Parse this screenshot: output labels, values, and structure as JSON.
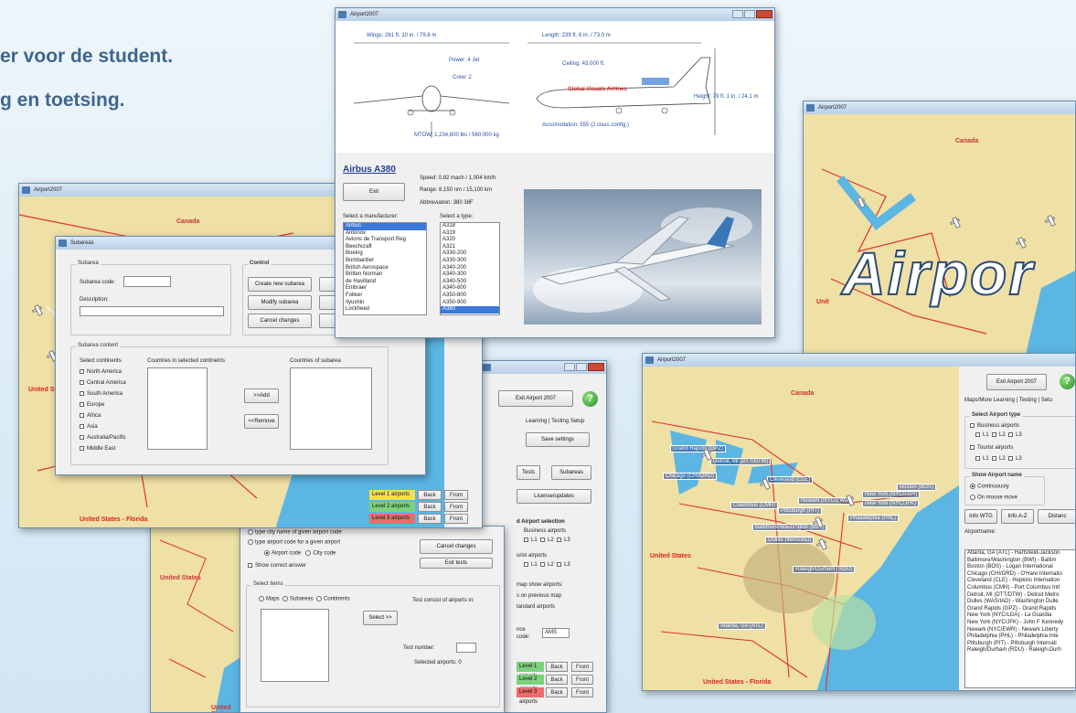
{
  "headline": {
    "line1": "er voor de student.",
    "line2": "g en toetsing."
  },
  "app_title": "Airport2007",
  "colors": {
    "sea": "#5bb6e3",
    "land": "#f0e0a6",
    "title_grad": "#c7d9ec",
    "accent": "#3b78d8",
    "level1": "#f5e04a",
    "level2": "#7cd27c",
    "level3": "#ef6b6b"
  },
  "map_labels": {
    "canada": "Canada",
    "united_states": "United States",
    "us_florida": "United States - Florida",
    "partial_us": "Unit"
  },
  "city_labels": [
    "Grand Rapids (GPZ)",
    "Detroit, MI (DTT/DTW)",
    "Chicago (CHI/ORD)",
    "Cleveland (CLE)",
    "Boston (BOS)",
    "New York (NYC/LGA)",
    "New York (NYC/JFK)",
    "Newark (NYC/EWR)",
    "Columbus (CMH)",
    "Pittsburgh (PIT)",
    "Philadelphia (PHL)",
    "Baltimore/Washington (BWI)",
    "Dulles (WAS/IAD)",
    "Raleigh/Durham (RDU)",
    "Atlanta, GA (ATL)"
  ],
  "airbus": {
    "dim_wings": "Wings: 261 ft. 10 in. / 79.8 m",
    "dim_length": "Length: 239 ft. 6 in. / 73.0 m",
    "power": "Power: 4 Jet",
    "crew": "Crew: 2",
    "ceiling": "Ceiling: 43,000 ft.",
    "airline": "Global Visuals Airlines",
    "height": "Height: 79 ft. 1 in. / 24.1 m",
    "mtow": "MTOW: 1,234,600 lbs / 560,000 kg",
    "accom": "Accomodation: 555 (2 class config.)",
    "name": "Airbus A380",
    "speed": "Speed: 0,82 mach / 1,004 km/h",
    "range": "Range: 8,150 nm / 15,100 km",
    "abbrev": "Abbreviation: 380 38F",
    "exit": "Exit",
    "manufacturer_label": "Select a manufacturer:",
    "type_label": "Select a type:",
    "manufacturers": [
      "Airbus",
      "Antonov",
      "Avions de Transport Reg",
      "Beechcraft",
      "Boeing",
      "Bombardier",
      "British Aerospace",
      "Britten Norman",
      "de Havilland",
      "Embraer",
      "Fokker",
      "Ilyushin",
      "Lockheed"
    ],
    "types": [
      "A318",
      "A319",
      "A320",
      "A321",
      "A330-200",
      "A330-300",
      "A340-200",
      "A340-300",
      "A340-500",
      "A340-600",
      "A350-800",
      "A350-900",
      "A380"
    ]
  },
  "logo_text": "Airpor",
  "subareas": {
    "title": "Subareas",
    "subarea_group": "Subarea",
    "code_label": "Subarea code:",
    "desc_label": "Description:",
    "control_group": "Control",
    "create": "Create new subarea",
    "modify": "Modify subarea",
    "cancel": "Cancel changes",
    "content_group": "Subarea content",
    "select_continents": "Select  continents",
    "continents": [
      "North America",
      "Central America",
      "South America",
      "Europe",
      "Africa",
      "Asia",
      "Australia/Pacific",
      "Middle East"
    ],
    "countries_sel": "Countries in selected continents",
    "countries_sub": "Countries of subarea",
    "add": ">>Add",
    "remove": "<<Remove"
  },
  "settings": {
    "exit": "Exit Airport 2007",
    "tabs": "Learning | Testing  Setup",
    "save": "Save settings",
    "tests": "Tests",
    "subareas": "Subareas",
    "license": "License/updates",
    "airport_selection": "d Airport selection",
    "business": "Business airports",
    "tourist": "urist airports",
    "map_show1": "map show airports:",
    "map_show2": "s on previous map",
    "map_show3": "tandard airports",
    "code_label1": "nce",
    "code_label2": "code:",
    "code_value": "AMS",
    "l1": "L1",
    "l2": "L2",
    "l3": "L3",
    "levels": [
      "Level 1 airports",
      "Level 2 airports",
      "Level 3 airports"
    ],
    "back": "Back",
    "front": "Front"
  },
  "test_form": {
    "opt1": "type city name of given airport code",
    "opt2": "type airport code for a given airport",
    "airport_code": "Airport code",
    "city_code": "City code",
    "show_correct": "Show correct answer",
    "cancel": "Cancel changes",
    "exit_tests": "Exit tests",
    "select_items": "Select items",
    "maps": "Maps",
    "subareas": "Subareas",
    "continents": "Continents",
    "select": "Select >>",
    "consist": "Test consist of airports in:",
    "test_number": "Test number:",
    "selected": "Selected airports:  0"
  },
  "main_panel": {
    "exit": "Exit Airport 2007",
    "tabs": "Maps/More   Learning  |  Testing  |  Setu",
    "select_type": "Select Airport type",
    "business": "Business airports",
    "tourist": "Tourist airports",
    "show_name": "Show Airport name",
    "continuously": "Continuously",
    "on_mouse": "On mouse move",
    "info_wtg": "Info  WTG",
    "info_az": "Info  A-Z",
    "distance": "Distanc",
    "airportname": "Airportname:",
    "airports": [
      "Atlanta, GA (ATL) - Hartsfield-Jackson",
      "Baltimore/Washington (BWI) - Baltim",
      "Boston (BOS) - Logan International",
      "Chicago (CHI/ORD) - O'Hare Internatio",
      "Cleveland (CLE) - Hopkins Internation",
      "Columbus (CMH) - Port Columbus Intl",
      "Detroit, MI (DTT/DTW) - Detroit Metro",
      "Dulles (WAS/IAD) - Washington Dulle",
      "Grand Rapids (GPZ) - Grand Rapids",
      "New York (NYC/LGA) - La Guardia",
      "New York (NYC/JFK) - John F Kennedy",
      "Newark (NYC/EWR) - Newark Liberty",
      "Philadelphia (PHL) - Philadelphia Inte",
      "Pittsburgh (PIT) - Pittsburgh Internati",
      "Raleigh/Durham (RDU) - Raleigh-Durh"
    ]
  }
}
